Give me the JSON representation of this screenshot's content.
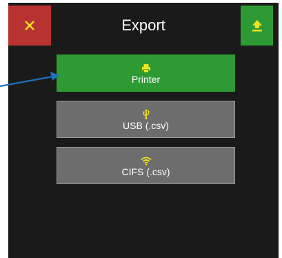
{
  "header": {
    "title": "Export",
    "close_icon": "close-icon",
    "upload_icon": "upload-icon"
  },
  "options": [
    {
      "label": "Printer",
      "icon": "printer-icon",
      "selected": true
    },
    {
      "label": "USB (.csv)",
      "icon": "usb-icon",
      "selected": false
    },
    {
      "label": "CIFS (.csv)",
      "icon": "wifi-icon",
      "selected": false
    }
  ],
  "colors": {
    "background": "#1a1a1a",
    "close_button": "#b93232",
    "accent_green": "#2e9a34",
    "option_gray": "#6d6d6d",
    "icon_yellow": "#f5e21a",
    "pointer_blue": "#1f6fbf"
  }
}
